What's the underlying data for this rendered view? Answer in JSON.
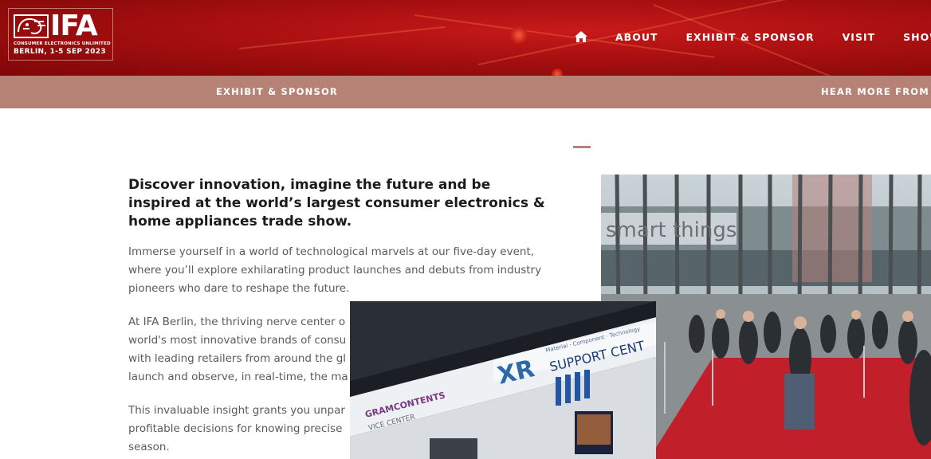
{
  "logo": {
    "word": "IFA",
    "tagline": "CONSUMER ELECTRONICS UNLIMITED",
    "date": "BERLIN, 1-5 SEP 2023"
  },
  "nav": {
    "home_icon": "home-icon",
    "items": [
      "ABOUT",
      "EXHIBIT & SPONSOR",
      "VISIT",
      "SHOW"
    ]
  },
  "subnav": {
    "left": "EXHIBIT & SPONSOR",
    "right": "HEAR MORE FROM"
  },
  "content": {
    "heading": "Discover innovation, imagine the future and be inspired at the world’s largest consumer electronics & home appliances trade show.",
    "paragraphs": [
      "Immerse yourself in a world of technological marvels at our five-day event, where you’ll explore exhilarating product launches and debuts from industry pioneers who dare to reshape the future.",
      "At IFA Berlin, the thriving nerve center o world's most innovative brands of consu with leading retailers from around the gl launch and observe, in real-time, the ma",
      "This invaluable insight grants you unpar profitable decisions for knowing precise season."
    ]
  },
  "images": {
    "hall_sign": "smart things",
    "booth_brand": "XR",
    "booth_sign": "SUPPORT CENT",
    "booth_sub": "Material · Component · Technology",
    "booth_side": "GRAMCONTENTS",
    "booth_side2": "VICE CENTER"
  },
  "colors": {
    "header_red": "#a80f10",
    "subbar": "#b68275",
    "heading_text": "#1b1b1b",
    "body_text": "#5b5b5b"
  }
}
